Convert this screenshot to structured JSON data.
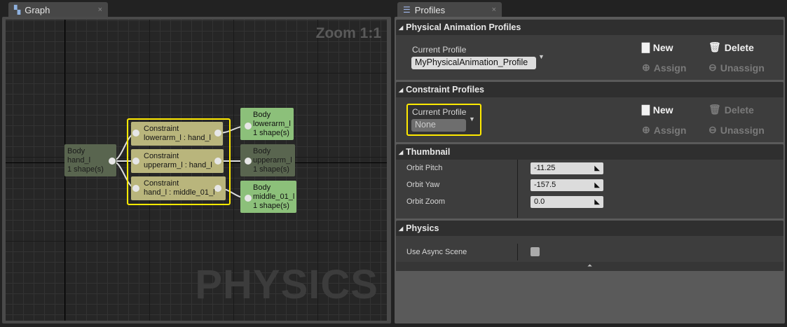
{
  "graph_tab": {
    "label": "Graph",
    "close": "×"
  },
  "graph": {
    "zoom": "Zoom 1:1",
    "watermark": "PHYSICS",
    "nodes": [
      {
        "l1": "Body",
        "l2": "hand_l",
        "l3": "1 shape(s)"
      },
      {
        "l1": "Constraint",
        "l2": "lowerarm_l : hand_l"
      },
      {
        "l1": "Constraint",
        "l2": "upperarm_l : hand_l"
      },
      {
        "l1": "Constraint",
        "l2": "hand_l : middle_01_l"
      },
      {
        "l1": "Body",
        "l2": "lowerarm_l",
        "l3": "1 shape(s)"
      },
      {
        "l1": "Body",
        "l2": "upperarm_l",
        "l3": "1 shape(s)"
      },
      {
        "l1": "Body",
        "l2": "middle_01_l",
        "l3": "1 shape(s)"
      }
    ]
  },
  "profiles_tab": {
    "label": "Profiles",
    "close": "×"
  },
  "pap": {
    "title": "Physical Animation Profiles",
    "current_label": "Current Profile",
    "current_value": "MyPhysicalAnimation_Profile",
    "new": "New",
    "delete": "Delete",
    "assign": "Assign",
    "unassign": "Unassign"
  },
  "cp": {
    "title": "Constraint Profiles",
    "current_label": "Current Profile",
    "current_value": "None",
    "new": "New",
    "delete": "Delete",
    "assign": "Assign",
    "unassign": "Unassign"
  },
  "thumbnail": {
    "title": "Thumbnail",
    "rows": [
      {
        "label": "Orbit Pitch",
        "value": "-11.25"
      },
      {
        "label": "Orbit Yaw",
        "value": "-157.5"
      },
      {
        "label": "Orbit Zoom",
        "value": "0.0"
      }
    ]
  },
  "physics": {
    "title": "Physics",
    "use_async_label": "Use Async Scene",
    "use_async_checked": false
  },
  "colors": {
    "selection": "#ffea00",
    "body_selected": "#8cc07a",
    "constraint": "#b9b57c"
  }
}
